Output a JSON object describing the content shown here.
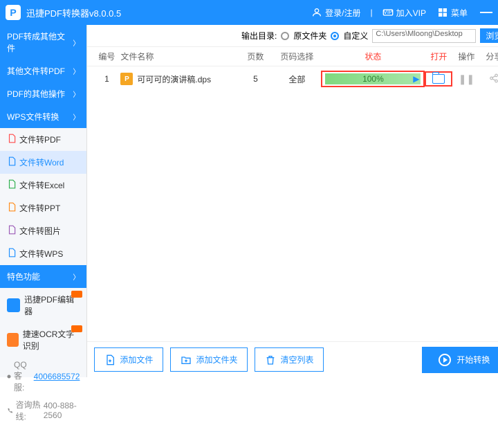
{
  "titlebar": {
    "title": "迅捷PDF转换器v8.0.0.5",
    "login": "登录/注册",
    "vip": "加入VIP",
    "menu": "菜单"
  },
  "sidebar": {
    "cats": [
      {
        "label": "PDF转成其他文件"
      },
      {
        "label": "其他文件转PDF"
      },
      {
        "label": "PDF的其他操作"
      },
      {
        "label": "WPS文件转换"
      }
    ],
    "items": [
      {
        "label": "文件转PDF",
        "color": "#ff4d4d"
      },
      {
        "label": "文件转Word",
        "color": "#1E90FF",
        "active": true
      },
      {
        "label": "文件转Excel",
        "color": "#2eaf4d"
      },
      {
        "label": "文件转PPT",
        "color": "#ff8c1a"
      },
      {
        "label": "文件转图片",
        "color": "#9b59b6"
      },
      {
        "label": "文件转WPS",
        "color": "#1E90FF"
      }
    ],
    "special": "特色功能",
    "ads": [
      {
        "label": "迅捷PDF编辑器",
        "bg": "#1E90FF"
      },
      {
        "label": "捷速OCR文字识别",
        "bg": "#ff7f27"
      }
    ],
    "qqlabel": "QQ 客服:",
    "qq": "4006685572",
    "hotlinelabel": "咨询热线:",
    "hotline": "400-888-2560"
  },
  "outbar": {
    "label": "输出目录:",
    "opt1": "原文件夹",
    "opt2": "自定义",
    "path": "C:\\Users\\Mloong\\Desktop",
    "browse": "浏览"
  },
  "table": {
    "headers": {
      "idx": "编号",
      "name": "文件名称",
      "pages": "页数",
      "pagesel": "页码选择",
      "status": "状态",
      "open": "打开",
      "op": "操作",
      "share": "分享"
    },
    "row": {
      "idx": "1",
      "name": "可可可的演讲稿.dps",
      "pages": "5",
      "pagesel": "全部",
      "progress": "100%"
    }
  },
  "bottom": {
    "addfile": "添加文件",
    "addfolder": "添加文件夹",
    "clear": "清空列表",
    "start": "开始转换"
  }
}
